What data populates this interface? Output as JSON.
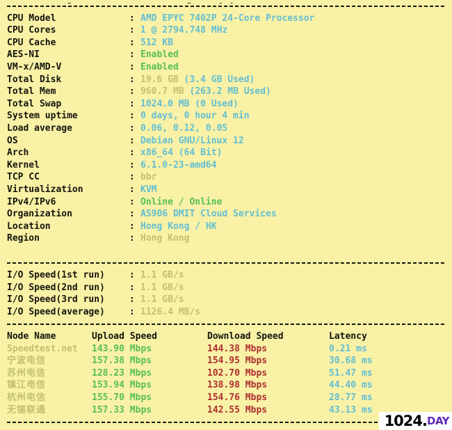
{
  "theme": {
    "background": "#f8f1a6",
    "label_color": "#15150d",
    "cyan": "#63bed2",
    "green": "#57bf54",
    "olive": "#c3c071",
    "red": "#ad2f2f",
    "watermark_purple": "#5b2bb5"
  },
  "clipped_top_line": "...........g............  .......g...,.y.y........................,",
  "system_info": {
    "rows": [
      {
        "label": "CPU Model",
        "value": "AMD EPYC 7402P 24-Core Processor",
        "color": "cyan"
      },
      {
        "label": "CPU Cores",
        "value": "1 @ 2794.748 MHz",
        "color": "cyan"
      },
      {
        "label": "CPU Cache",
        "value": "512 KB",
        "color": "cyan"
      },
      {
        "label": "AES-NI",
        "value": "Enabled",
        "color": "green"
      },
      {
        "label": "VM-x/AMD-V",
        "value": "Enabled",
        "color": "green"
      },
      {
        "label": "Total Disk",
        "value": "19.6 GB (3.4 GB Used)",
        "color": "olive-cyan"
      },
      {
        "label": "Total Mem",
        "value": "960.7 MB (263.2 MB Used)",
        "color": "olive-cyan"
      },
      {
        "label": "Total Swap",
        "value": "1024.0 MB (0 Used)",
        "color": "cyan"
      },
      {
        "label": "System uptime",
        "value": "0 days, 0 hour 4 min",
        "color": "cyan"
      },
      {
        "label": "Load average",
        "value": "0.06, 0.12, 0.05",
        "color": "cyan"
      },
      {
        "label": "OS",
        "value": "Debian GNU/Linux 12",
        "color": "cyan"
      },
      {
        "label": "Arch",
        "value": "x86_64 (64 Bit)",
        "color": "cyan"
      },
      {
        "label": "Kernel",
        "value": "6.1.0-23-amd64",
        "color": "cyan"
      },
      {
        "label": "TCP CC",
        "value": "bbr",
        "color": "olive"
      },
      {
        "label": "Virtualization",
        "value": "KVM",
        "color": "cyan"
      },
      {
        "label": "IPv4/IPv6",
        "value": "Online / Online",
        "color": "green"
      },
      {
        "label": "Organization",
        "value": "AS906 DMIT Cloud Services",
        "color": "cyan"
      },
      {
        "label": "Location",
        "value": "Hong Kong / HK",
        "color": "cyan"
      },
      {
        "label": "Region",
        "value": "Hong Kong",
        "color": "olive"
      }
    ]
  },
  "io_speed": {
    "rows": [
      {
        "label": "I/O Speed(1st run)",
        "value": "1.1 GB/s",
        "color": "olive"
      },
      {
        "label": "I/O Speed(2nd run)",
        "value": "1.1 GB/s",
        "color": "olive"
      },
      {
        "label": "I/O Speed(3rd run)",
        "value": "1.1 GB/s",
        "color": "olive"
      },
      {
        "label": "I/O Speed(average)",
        "value": "1126.4 MB/s",
        "color": "olive"
      }
    ]
  },
  "speedtest": {
    "headers": {
      "node": "Node Name",
      "upload": "Upload Speed",
      "download": "Download Speed",
      "latency": "Latency"
    },
    "rows": [
      {
        "node": "Speedtest.net",
        "upload": "143.90 Mbps",
        "download": "144.38 Mbps",
        "latency": "0.21 ms",
        "cjk": false
      },
      {
        "node": "宁波电信",
        "upload": "157.38 Mbps",
        "download": "154.95 Mbps",
        "latency": "30.68 ms",
        "cjk": true
      },
      {
        "node": "苏州电信",
        "upload": "128.23 Mbps",
        "download": "102.70 Mbps",
        "latency": "51.47 ms",
        "cjk": true
      },
      {
        "node": "镇江电信",
        "upload": "153.94 Mbps",
        "download": "138.98 Mbps",
        "latency": "44.40 ms",
        "cjk": true
      },
      {
        "node": "杭州电信",
        "upload": "155.70 Mbps",
        "download": "154.76 Mbps",
        "latency": "28.77 ms",
        "cjk": true
      },
      {
        "node": "无锡联通",
        "upload": "157.33 Mbps",
        "download": "142.55 Mbps",
        "latency": "43.13 ms",
        "cjk": true
      }
    ]
  },
  "watermark": {
    "number": "1024",
    "dot": ".",
    "suffix": "DAY"
  },
  "separator_char": "-"
}
